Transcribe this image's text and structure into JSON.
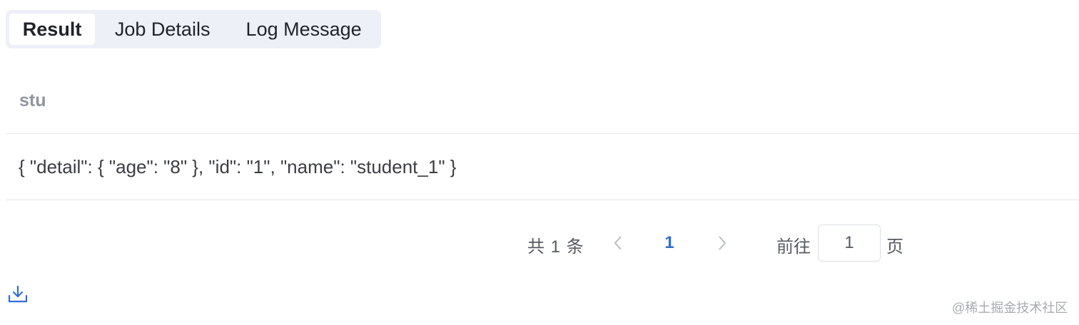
{
  "tabs": [
    {
      "label": "Result",
      "active": true
    },
    {
      "label": "Job Details",
      "active": false
    },
    {
      "label": "Log Message",
      "active": false
    }
  ],
  "table": {
    "columns": [
      "stu"
    ],
    "rows": [
      [
        "{ \"detail\": { \"age\": \"8\" }, \"id\": \"1\", \"name\": \"student_1\" }"
      ]
    ]
  },
  "pagination": {
    "total_text": "共 1 条",
    "current_page": "1",
    "goto_label": "前往",
    "goto_value": "1",
    "page_unit": "页",
    "accent_color": "#2f6fd1"
  },
  "download": {
    "icon": "download-icon"
  },
  "watermark": "@稀土掘金技术社区"
}
